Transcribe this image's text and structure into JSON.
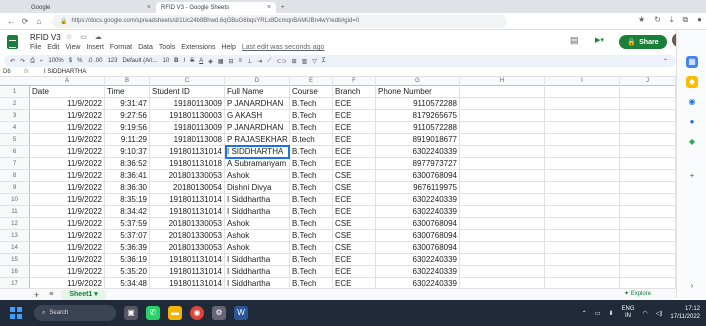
{
  "browser": {
    "tabs": [
      {
        "label": "Google"
      },
      {
        "label": "RFID V3 - Google Sheets"
      }
    ],
    "new_tab": "+",
    "url": "https://docs.google.com/spreadsheets/d/1Uc24b9Bhwd.6qGBuG6bqsYRLx8DcmqnBAMUBn4wY/edit#gid=0"
  },
  "doc": {
    "title": "RFID V3",
    "menus": [
      "File",
      "Edit",
      "View",
      "Insert",
      "Format",
      "Data",
      "Tools",
      "Extensions",
      "Help"
    ],
    "last_edit": "Last edit was seconds ago",
    "share_label": "Share"
  },
  "toolbar": {
    "zoom": "100%",
    "currency": "$",
    "percent": "%",
    "decimals": ".0 .00",
    "format": "123",
    "font": "Default (Ari...",
    "size": "10"
  },
  "formula": {
    "namebox": "D6",
    "fx": "fx",
    "value": "I SIDDHARTHA"
  },
  "columns": [
    "A",
    "B",
    "C",
    "D",
    "E",
    "F",
    "G",
    "H",
    "I",
    "J"
  ],
  "rows": [
    [
      "Date",
      "Time",
      "Student ID",
      "Full Name",
      "Course",
      "Branch",
      "Phone Number"
    ],
    [
      "11/9/2022",
      "9:31:47",
      "19180113009",
      "P JANARDHAN",
      "B.Tech",
      "ECE",
      "9110572288"
    ],
    [
      "11/9/2022",
      "9:27:56",
      "191801130003",
      "G AKASH",
      "B.Tech",
      "ECE",
      "8179265675"
    ],
    [
      "11/9/2022",
      "9:19:56",
      "19180113009",
      "P JANARDHAN",
      "B.Tech",
      "ECE",
      "9110572288"
    ],
    [
      "11/9/2022",
      "9:11:29",
      "19180113008",
      "P RAJASEKHAR",
      "B.tech",
      "ECE",
      "8919018677"
    ],
    [
      "11/9/2022",
      "9:10:37",
      "191801131014",
      "I SIDDHARTHA",
      "B.Tech",
      "ECE",
      "6302240339"
    ],
    [
      "11/9/2022",
      "8:36:52",
      "191801131018",
      "A Subramanyam",
      "B.Tech",
      "ECE",
      "8977973727"
    ],
    [
      "11/9/2022",
      "8:36:41",
      "201801330053",
      "Ashok",
      "B.Tech",
      "CSE",
      "6300768094"
    ],
    [
      "11/9/2022",
      "8:36:30",
      "20180130054",
      "Dishni Divya",
      "B.Tech",
      "CSE",
      "9676119975"
    ],
    [
      "11/9/2022",
      "8:35:19",
      "191801131014",
      "I Siddhartha",
      "B.Tech",
      "ECE",
      "6302240339"
    ],
    [
      "11/9/2022",
      "8:34:42",
      "191801131014",
      "I Siddhartha",
      "B.Tech",
      "ECE",
      "6302240339"
    ],
    [
      "11/9/2022",
      "5:37:59",
      "201801330053",
      "Ashok",
      "B.Tech",
      "CSE",
      "6300768094"
    ],
    [
      "11/9/2022",
      "5:37:07",
      "201801330053",
      "Ashok",
      "B.Tech",
      "CSE",
      "6300768094"
    ],
    [
      "11/9/2022",
      "5:36:39",
      "201801330053",
      "Ashok",
      "B.Tech",
      "CSE",
      "6300768094"
    ],
    [
      "11/9/2022",
      "5:36:19",
      "191801131014",
      "I Siddhartha",
      "B.Tech",
      "ECE",
      "6302240339"
    ],
    [
      "11/9/2022",
      "5:35:20",
      "191801131014",
      "I Siddhartha",
      "B.Tech",
      "ECE",
      "6302240339"
    ],
    [
      "11/9/2022",
      "5:34:48",
      "191801131014",
      "I Siddhartha",
      "B.Tech",
      "ECE",
      "6302240339"
    ]
  ],
  "sheet": {
    "name": "Sheet1",
    "add": "+",
    "explore": "Explore"
  },
  "taskbar": {
    "search": "Search",
    "lang": "ENG",
    "region": "IN",
    "time": "17:12",
    "date": "17/11/2022"
  }
}
